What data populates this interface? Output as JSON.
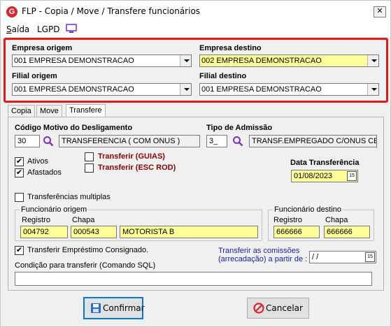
{
  "window": {
    "logo_letter": "G",
    "title": "FLP - Copia / Move / Transfere funcionários",
    "close": "✕"
  },
  "menu": {
    "saida_u": "S",
    "saida_rest": "aída",
    "lgpd": "LGPD",
    "monitor_icon": "monitor-icon"
  },
  "empresa_origem": {
    "label": "Empresa origem",
    "value": "001 EMPRESA DEMONSTRACAO"
  },
  "empresa_destino": {
    "label": "Empresa destino",
    "value": "002 EMPRESA DEMONSTRACAO"
  },
  "filial_origem": {
    "label": "Filial origem",
    "value": "001 EMPRESA DEMONSTRACAO"
  },
  "filial_destino": {
    "label": "Filial destino",
    "value": "001 EMPRESA DEMONSTRACAO"
  },
  "tabs": [
    {
      "label": "Copia",
      "active": false
    },
    {
      "label": "Move",
      "active": false
    },
    {
      "label": "Transfere",
      "active": true
    }
  ],
  "motivo": {
    "label": "Código Motivo do Desligamento",
    "code": "30",
    "description": "TRANSFERENCIA ( COM ONUS )"
  },
  "admissao": {
    "label": "Tipo de Admissão",
    "code": "3_",
    "description": "TRANSF.EMPREGADO C/ONUS CE"
  },
  "checks": {
    "ativos": {
      "label": "Ativos",
      "checked": true
    },
    "afastados": {
      "label": "Afastados",
      "checked": true
    },
    "guias": {
      "label": "Transferir (GUIAS)",
      "checked": false
    },
    "esc_rod": {
      "label": "Transferir (ESC ROD)",
      "checked": false
    },
    "multiplas": {
      "label": "Transferências multiplas",
      "checked": false
    },
    "consignado": {
      "label": "Transferir Empréstimo Consignado.",
      "checked": true
    }
  },
  "data_transferencia": {
    "label": "Data Transferência",
    "value": "01/08/2023"
  },
  "func_origem": {
    "title": "Funcionário origem",
    "registro_label": "Registro",
    "chapa_label": "Chapa",
    "registro": "004792",
    "chapa": "000543",
    "nome": "MOTORISTA B"
  },
  "func_destino": {
    "title": "Funcionário destino",
    "registro_label": "Registro",
    "chapa_label": "Chapa",
    "registro": "666666",
    "chapa": "666666"
  },
  "comissoes": {
    "line1": "Transferir as comissões",
    "line2": "(arrecadação)  a partir de :",
    "value": " / /"
  },
  "condicao": {
    "label": "Condição para transferir (Comando SQL)",
    "value": ""
  },
  "buttons": {
    "confirmar": "Confirmar",
    "cancelar": "Cancelar"
  },
  "colors": {
    "highlight_frame": "#e01b1b",
    "yellow_field": "#ffff99",
    "dark_red_label": "#8b0000",
    "blue_label": "#1a1aa0"
  }
}
